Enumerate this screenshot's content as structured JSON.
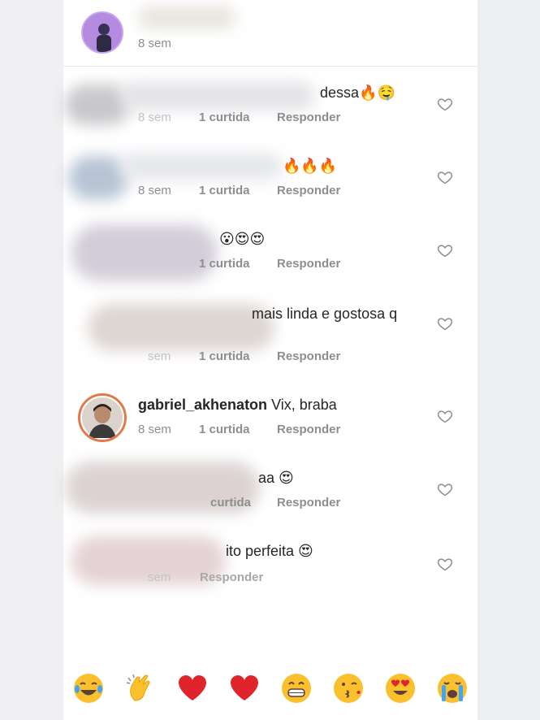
{
  "header": {
    "time": "8 sem"
  },
  "comments": [
    {
      "text": "dessa🔥🤤",
      "time": "8 sem",
      "likes": "1 curtida",
      "reply": "Responder"
    },
    {
      "text": "🔥🔥🔥",
      "time": "8 sem",
      "likes": "1 curtida",
      "reply": "Responder"
    },
    {
      "text": "😮😍😍",
      "time": "",
      "likes": "1 curtida",
      "reply": "Responder"
    },
    {
      "text": "mais linda e gostosa q",
      "time": "sem",
      "likes": "1 curtida",
      "reply": "Responder"
    },
    {
      "username": "gabriel_akhenaton",
      "text": "Vix, braba",
      "time": "8 sem",
      "likes": "1 curtida",
      "reply": "Responder"
    },
    {
      "text": "aa 😍",
      "time": "",
      "likes": "curtida",
      "reply": "Responder"
    },
    {
      "text": "ito perfeita 😍",
      "time": "sem",
      "likes": "",
      "reply": "Responder"
    }
  ],
  "emoji_bar": [
    "laughing-tears",
    "clapping-hands",
    "red-heart",
    "red-heart",
    "grinning",
    "kissing",
    "heart-eyes",
    "crying"
  ],
  "colors": {
    "heart_red": "#e0242c",
    "emoji_yellow": "#fbc02d",
    "meta_grey": "#8e8e8e"
  }
}
